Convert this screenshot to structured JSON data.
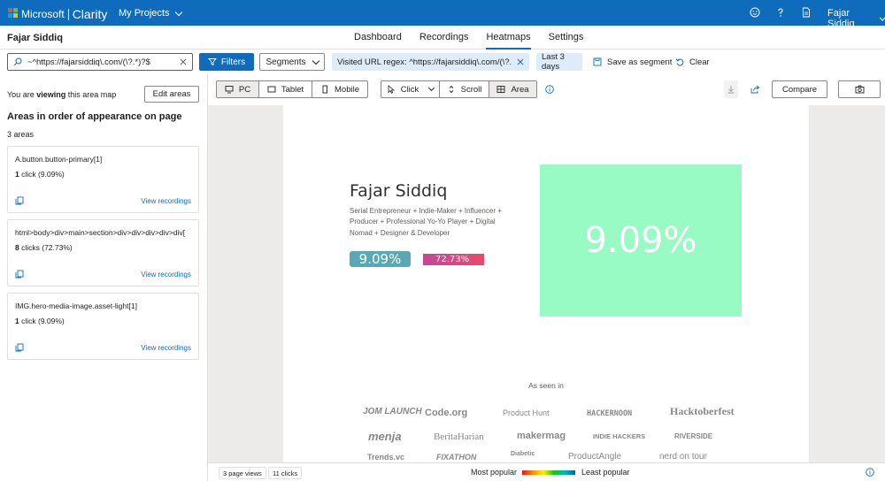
{
  "topbar": {
    "brand": "Microsoft",
    "product": "Clarity",
    "projects_label": "My Projects",
    "user_name": "Fajar Siddiq",
    "colors": {
      "bar": "#0f6cbd",
      "logo_red": "#f25022",
      "logo_green": "#7fba00",
      "logo_blue": "#00a4ef",
      "logo_yellow": "#ffb900"
    }
  },
  "subheader": {
    "site_name": "Fajar Siddiq",
    "tabs": [
      {
        "label": "Dashboard",
        "active": false
      },
      {
        "label": "Recordings",
        "active": false
      },
      {
        "label": "Heatmaps",
        "active": true
      },
      {
        "label": "Settings",
        "active": false
      }
    ]
  },
  "filters": {
    "url_value": "~^https://fajarsiddiq\\.com/(\\?.*)?$",
    "filters_label": "Filters",
    "segments_label": "Segments",
    "visited_chip": "Visited URL regex: ^https://fajarsiddiq\\.com/(\\?.*)?$",
    "date_chip": "Last 3 days",
    "save_segment": "Save as segment",
    "clear": "Clear"
  },
  "left_panel": {
    "viewing_prefix": "You are ",
    "viewing_bold": "viewing",
    "viewing_suffix": " this area map",
    "edit_areas": "Edit areas",
    "title": "Areas in order of appearance on page",
    "count": "3 areas",
    "areas": [
      {
        "selector": "A.button.button-primary[1]",
        "clicks_num": "1",
        "clicks_text": "click (9.09%)",
        "view": "View recordings"
      },
      {
        "selector": "html>body>div>main>section>div>div>div>div>div[",
        "clicks_num": "8",
        "clicks_text": "clicks (72.73%)",
        "view": "View recordings"
      },
      {
        "selector": "IMG.hero-media-image.asset-light[1]",
        "clicks_num": "1",
        "clicks_text": "click (9.09%)",
        "view": "View recordings"
      }
    ]
  },
  "toolbar": {
    "devices": [
      {
        "label": "PC",
        "icon": "monitor-icon",
        "selected": true
      },
      {
        "label": "Tablet",
        "icon": "tablet-icon",
        "selected": false
      },
      {
        "label": "Mobile",
        "icon": "mobile-icon",
        "selected": false
      }
    ],
    "modes": [
      {
        "label": "Click",
        "icon": "cursor-icon",
        "selected": false
      },
      {
        "label": "Scroll",
        "icon": "scroll-icon",
        "selected": false
      },
      {
        "label": "Area",
        "icon": "area-icon",
        "selected": true
      }
    ],
    "compare": "Compare"
  },
  "page_preview": {
    "name": "Fajar Siddiq",
    "description": "Serial Entrepreneur + Indie-Maker + Influencer + Producer + Professional Yo-Yo Player + Digital Nomad + Designer & Developer",
    "area_btn1_pct": "9.09%",
    "area_btn2_pct": "72.73%",
    "area_img_pct": "9.09%",
    "as_seen_in": "As seen in",
    "logos": [
      "JOM LAUNCH",
      "Code.org",
      "Product Hunt",
      "HACKERNOON",
      "Hacktoberfest",
      "menja",
      "BeritaHarian",
      "makermag",
      "INDIE HACKERS",
      "RIVERSIDE",
      "Trends.vc",
      "FIXATHON",
      "Diabetic",
      "ProductAngle",
      "nerd on tour"
    ]
  },
  "bottom": {
    "page_views": "3 page views",
    "clicks": "11 clicks",
    "most_popular": "Most popular",
    "least_popular": "Least popular"
  }
}
